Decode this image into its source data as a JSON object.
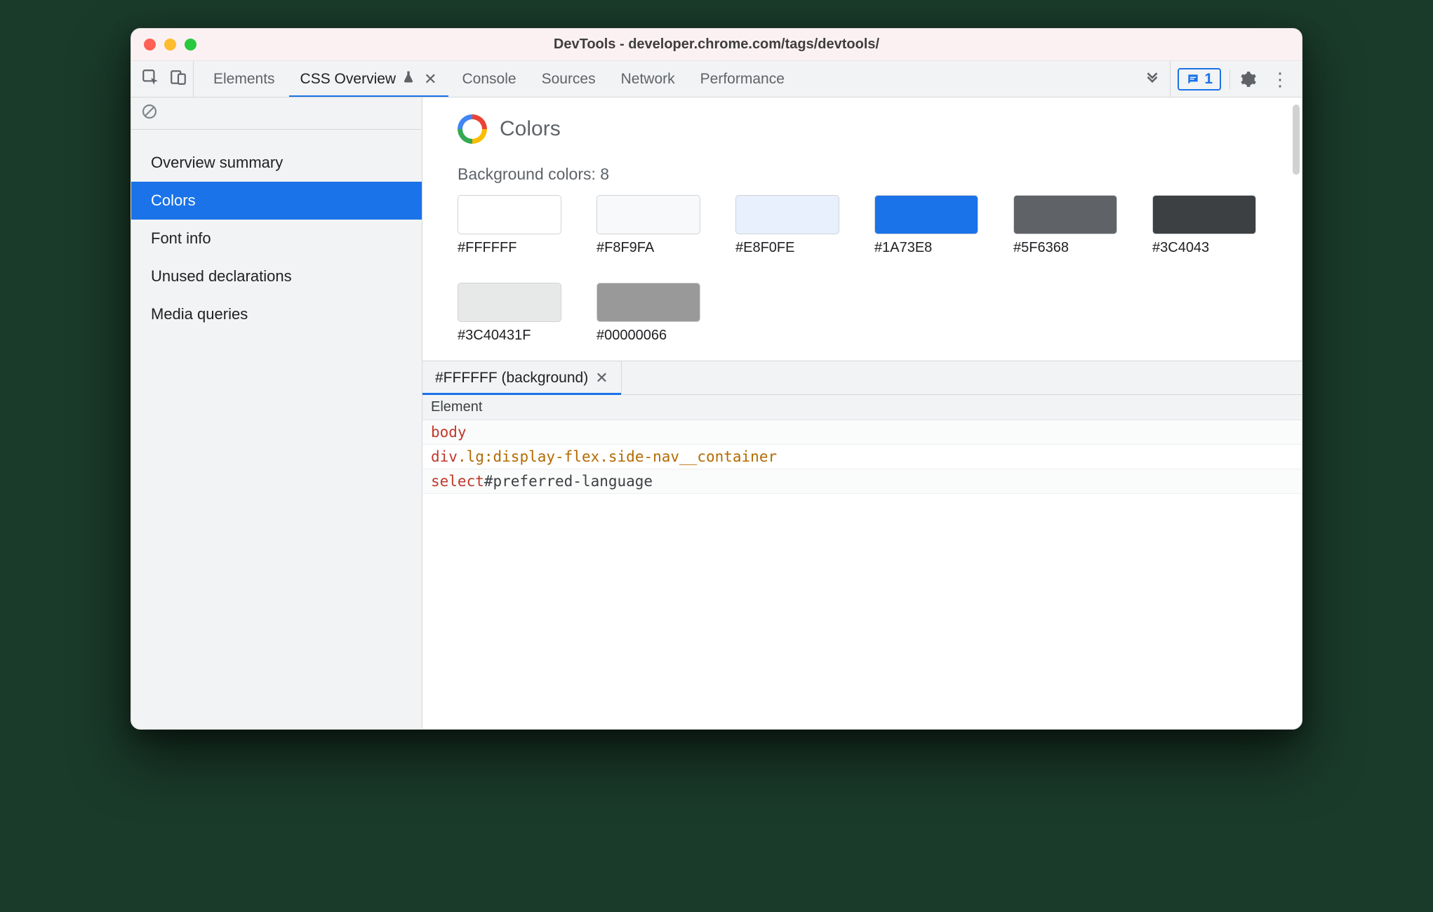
{
  "window": {
    "title": "DevTools - developer.chrome.com/tags/devtools/"
  },
  "tabs": {
    "items": [
      {
        "label": "Elements"
      },
      {
        "label": "CSS Overview",
        "active": true,
        "experimental": true,
        "closeable": true
      },
      {
        "label": "Console"
      },
      {
        "label": "Sources"
      },
      {
        "label": "Network"
      },
      {
        "label": "Performance"
      }
    ],
    "issues_count": "1"
  },
  "sidebar": {
    "items": [
      {
        "label": "Overview summary"
      },
      {
        "label": "Colors",
        "selected": true
      },
      {
        "label": "Font info"
      },
      {
        "label": "Unused declarations"
      },
      {
        "label": "Media queries"
      }
    ]
  },
  "colors": {
    "section_title": "Colors",
    "subhead": "Background colors: 8",
    "swatches": [
      {
        "hex": "#FFFFFF",
        "css": "#FFFFFF"
      },
      {
        "hex": "#F8F9FA",
        "css": "#F8F9FA"
      },
      {
        "hex": "#E8F0FE",
        "css": "#E8F0FE"
      },
      {
        "hex": "#1A73E8",
        "css": "#1A73E8"
      },
      {
        "hex": "#5F6368",
        "css": "#5F6368"
      },
      {
        "hex": "#3C4043",
        "css": "#3C4043"
      },
      {
        "hex": "#3C40431F",
        "css": "rgba(60,64,67,0.12)"
      },
      {
        "hex": "#00000066",
        "css": "rgba(0,0,0,0.40)"
      }
    ]
  },
  "details": {
    "tab_label": "#FFFFFF (background)",
    "column_header": "Element",
    "rows": [
      {
        "tag": "body",
        "rest": ""
      },
      {
        "tag": "div",
        "rest": ".lg:display-flex.side-nav__container"
      },
      {
        "tag": "select",
        "rest": "#preferred-language"
      }
    ]
  }
}
